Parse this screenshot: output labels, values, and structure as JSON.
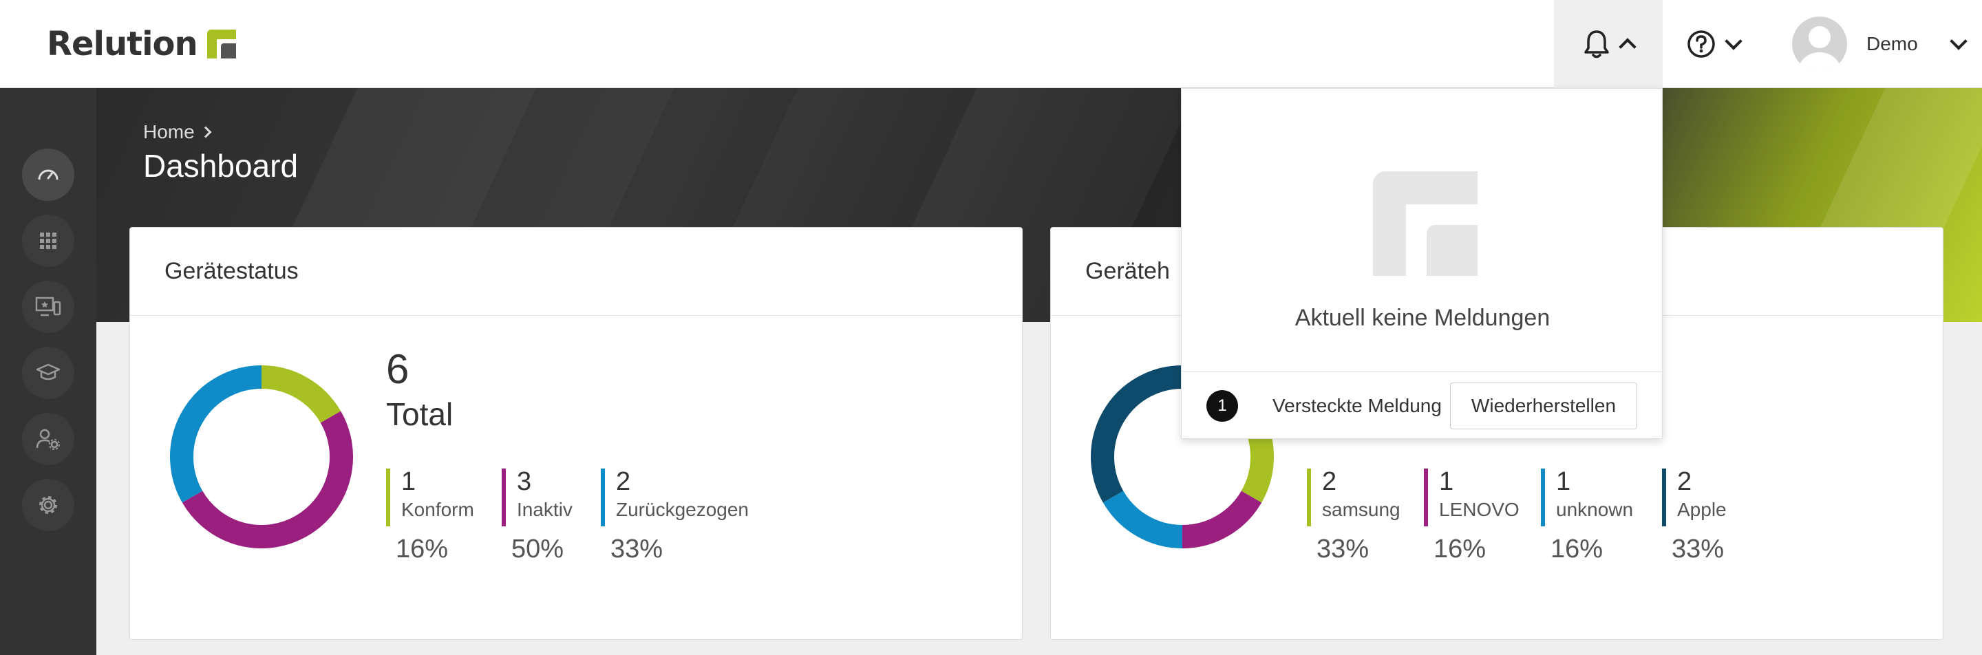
{
  "app": {
    "logo_text": "Relution"
  },
  "topbar": {
    "user_name": "Demo"
  },
  "sidebar": {
    "items": [
      {
        "icon": "dashboard-icon",
        "active": true
      },
      {
        "icon": "apps-grid-icon"
      },
      {
        "icon": "devices-icon"
      },
      {
        "icon": "education-icon"
      },
      {
        "icon": "user-settings-icon"
      },
      {
        "icon": "gear-icon"
      }
    ]
  },
  "header": {
    "breadcrumb": [
      "Home"
    ],
    "title": "Dashboard"
  },
  "cards": {
    "device_status": {
      "title": "Gerätestatus",
      "total_number": "6",
      "total_label": "Total",
      "stats": [
        {
          "count": "1",
          "label": "Konform",
          "percent": "16%",
          "color": "#a8c023"
        },
        {
          "count": "3",
          "label": "Inaktiv",
          "percent": "50%",
          "color": "#9b1f7f"
        },
        {
          "count": "2",
          "label": "Zurückgezogen",
          "percent": "33%",
          "color": "#0f8bc7"
        }
      ]
    },
    "device_vendor": {
      "title": "Geräteh",
      "stats": [
        {
          "count": "2",
          "label": "samsung",
          "percent": "33%",
          "color": "#a8c023"
        },
        {
          "count": "1",
          "label": "LENOVO",
          "percent": "16%",
          "color": "#9b1f7f"
        },
        {
          "count": "1",
          "label": "unknown",
          "percent": "16%",
          "color": "#0f8bc7"
        },
        {
          "count": "2",
          "label": "Apple",
          "percent": "33%",
          "color": "#0d4a6b"
        }
      ]
    }
  },
  "notifications": {
    "empty_text": "Aktuell keine Meldungen",
    "hidden_count": "1",
    "hidden_text": "Versteckte Meldung",
    "restore_label": "Wiederherstellen"
  },
  "chart_data": [
    {
      "type": "pie",
      "categories": [
        "Konform",
        "Inaktiv",
        "Zurückgezogen"
      ],
      "values": [
        1,
        3,
        2
      ]
    },
    {
      "type": "pie",
      "categories": [
        "samsung",
        "LENOVO",
        "unknown",
        "Apple"
      ],
      "values": [
        2,
        1,
        1,
        2
      ]
    }
  ]
}
